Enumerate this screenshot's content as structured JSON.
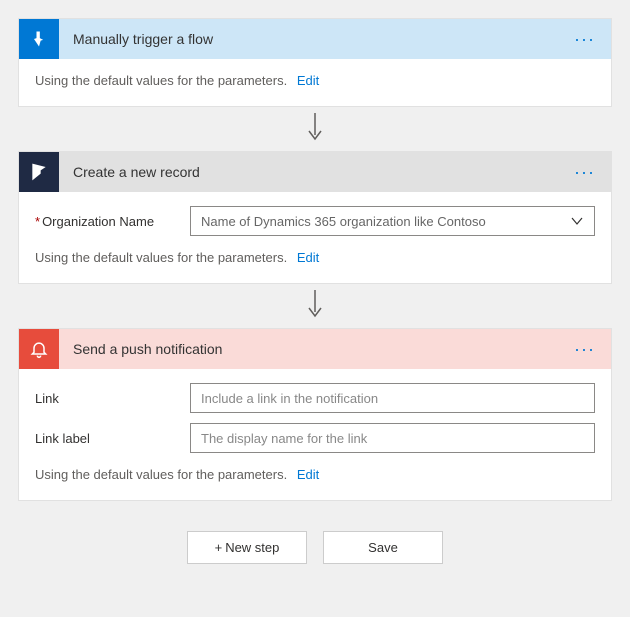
{
  "steps": {
    "trigger": {
      "title": "Manually trigger a flow",
      "defaults_text": "Using the default values for the parameters.",
      "edit_label": "Edit"
    },
    "create_record": {
      "title": "Create a new record",
      "org_label": "Organization Name",
      "org_placeholder": "Name of Dynamics 365 organization like Contoso",
      "defaults_text": "Using the default values for the parameters.",
      "edit_label": "Edit"
    },
    "push": {
      "title": "Send a push notification",
      "link_label": "Link",
      "link_placeholder": "Include a link in the notification",
      "link_label_label": "Link label",
      "link_label_placeholder": "The display name for the link",
      "defaults_text": "Using the default values for the parameters.",
      "edit_label": "Edit"
    }
  },
  "footer": {
    "new_step": "New step",
    "save": "Save"
  }
}
